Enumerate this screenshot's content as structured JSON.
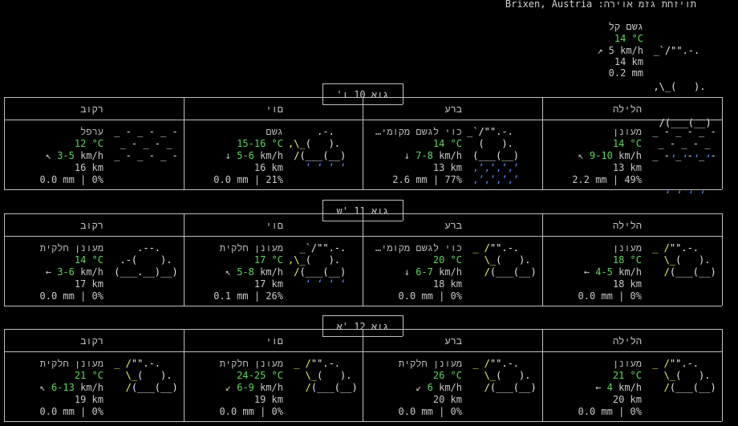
{
  "header": {
    "title": "Brixen, Austria :תויזחת גזמ אוירה",
    "current": {
      "condition": "גשם קל",
      "temp": "14 °C",
      "wind": "↗ 5 km/h",
      "visibility": "14 km",
      "precip": "0.2 mm",
      "icon_lines": [
        "  _`/\"\".-.    ",
        "  ,\\_(   ).   ",
        "   /(___(__)  ",
        "     ʻ ʻ ʻ ʻ  ",
        "    ʻ ʻ ʻ ʻ   "
      ]
    }
  },
  "days": [
    {
      "date": "'גוא 10 ו",
      "periods": [
        "רקוב",
        "םוי",
        "ברע",
        "הלילה"
      ],
      "cells": [
        {
          "condition": "ערפל",
          "temp": "12 °C",
          "wind": "↖ 3-5 km/h",
          "visibility": "16 km",
          "precip": "0.0 mm | 0%",
          "icon": [
            " _ - _ - _ - ",
            "  _ - _ - _  ",
            " _ - _ - _ - "
          ]
        },
        {
          "condition": "גשם",
          "temp": "15-16 °C",
          "wind": "↓ 5-6 km/h",
          "visibility": "16 km",
          "precip": "0.0 mm | 21%",
          "icon": [
            "     .-.     ",
            ",\\_(   ).   ",
            " /(___(__)  ",
            "   ʻ ʻ ʻ ʻ  "
          ]
        },
        {
          "condition": "…כוי לגשם מקומי",
          "temp": "14 °C",
          "wind": "↓ 7-8 km/h",
          "visibility": "13 km",
          "precip": "2.6 mm | 77%",
          "icon": [
            "_`/\"\".-.    ",
            "  (   ).    ",
            " (___(__)   ",
            " ‚ʻ‚ʻ‚ʻ‚ʻ   ",
            " ‚’‚’‚’‚’   "
          ]
        },
        {
          "condition": "מעונן",
          "temp": "14 °C",
          "wind": "↖ 9-10 km/h",
          "visibility": "13 km",
          "precip": "2.2 mm | 49%",
          "icon": [
            " _ - _ - _ - ",
            "  _ - _ - _  ",
            " _ - _ - _ - "
          ]
        }
      ]
    },
    {
      "date": "גוא 11 'ש",
      "periods": [
        "רקוב",
        "םוי",
        "ברע",
        "הלילה"
      ],
      "cells": [
        {
          "condition": "מעונן חלקית",
          "temp": "14 °C",
          "wind": "← 3-6 km/h",
          "visibility": "17 km",
          "precip": "0.0 mm | 0%",
          "icon": [
            "     .--.    ",
            "  .-(    ).  ",
            " (___.__)__) "
          ]
        },
        {
          "condition": "מעונן חלקית",
          "temp": "17 °C",
          "wind": "↖ 5-8 km/h",
          "visibility": "17 km",
          "precip": "0.1 mm | 26%",
          "icon": [
            "  _`/\"\".-.  ",
            ",\\_(   ).   ",
            " /(___(__)  ",
            "   ʻ ʻ ʻ ʻ  "
          ]
        },
        {
          "condition": "…כוי לגשם מקומי",
          "temp": "20 °C",
          "wind": "↓ 6-7 km/h",
          "visibility": "18 km",
          "precip": "0.0 mm | 0%",
          "icon": [
            " _ /\"\".-.  ",
            "   \\_(   ). ",
            "   /(___(__)"
          ]
        },
        {
          "condition": "מעונן",
          "temp": "18 °C",
          "wind": "← 4-5 km/h",
          "visibility": "18 km",
          "precip": "0.0 mm | 0%",
          "icon": [
            " _ /\"\".-.  ",
            "   \\_(   ). ",
            "   /(___(__)"
          ]
        }
      ]
    },
    {
      "date": "גוא 12 'א",
      "periods": [
        "רקוב",
        "םוי",
        "ברע",
        "הלילה"
      ],
      "cells": [
        {
          "condition": "מעונן חלקית",
          "temp": "21 °C",
          "wind": "↖ 6-13 km/h",
          "visibility": "19 km",
          "precip": "0.0 mm | 0%",
          "icon": [
            " _ /\"\".-.  ",
            "   \\_(   ). ",
            "   /(___(__)"
          ]
        },
        {
          "condition": "מעונן חלקית",
          "temp": "24-25 °C",
          "wind": "↙ 6-9 km/h",
          "visibility": "19 km",
          "precip": "0.0 mm | 0%",
          "icon": [
            " _ /\"\".-.  ",
            "   \\_(   ). ",
            "   /(___(__)"
          ]
        },
        {
          "condition": "מעונן חלקית",
          "temp": "26 °C",
          "wind": "↙ 6 km/h",
          "visibility": "20 km",
          "precip": "0.0 mm | 0%",
          "icon": [
            " _ /\"\".-.  ",
            "   \\_(   ). ",
            "   /(___(__)"
          ]
        },
        {
          "condition": "מעונן",
          "temp": "21 °C",
          "wind": "← 4 km/h",
          "visibility": "20 km",
          "precip": "0.0 mm | 0%",
          "icon": [
            " _ /\"\".-.  ",
            "   \\_(   ). ",
            "   /(___(__)"
          ]
        }
      ]
    }
  ],
  "colors": {
    "temp": "#5fd75f",
    "sun": "#f5f55f",
    "rain": "#5f87ff",
    "text": "#c8c8c8",
    "border": "#bfbfbf"
  }
}
